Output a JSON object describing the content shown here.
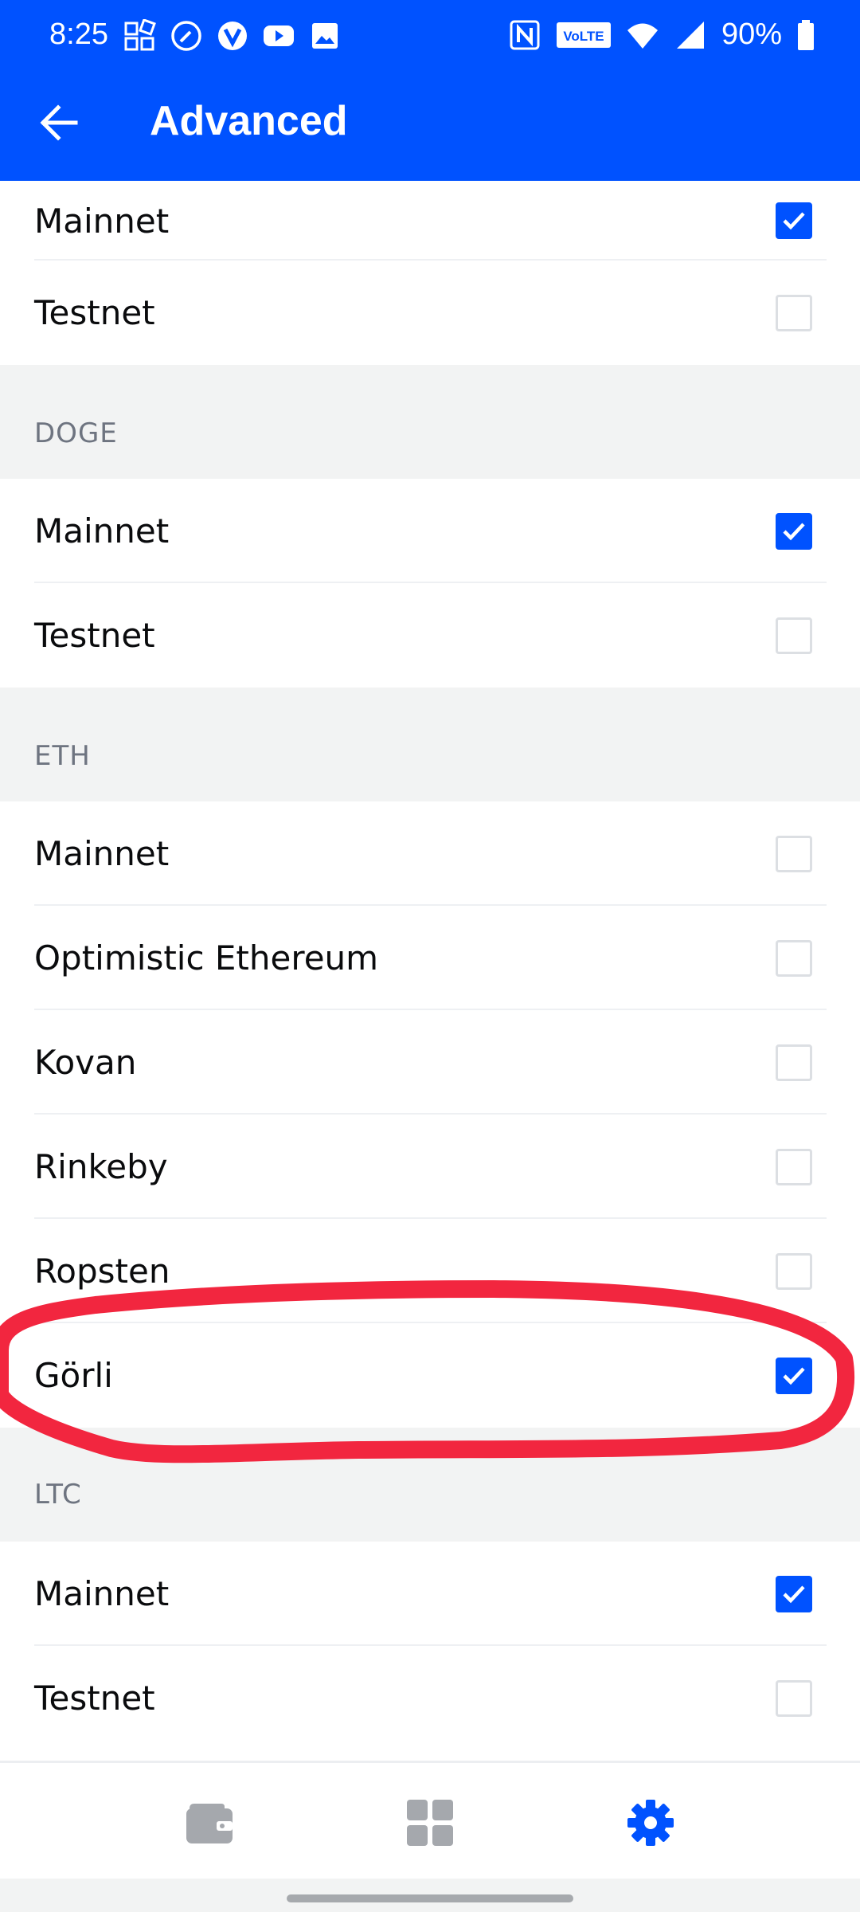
{
  "status_bar": {
    "time": "8:25",
    "battery": "90%",
    "volte": "VoLTE"
  },
  "app_bar": {
    "title": "Advanced"
  },
  "top_partial_rows": [
    {
      "label": "Mainnet",
      "checked": true
    },
    {
      "label": "Testnet",
      "checked": false
    }
  ],
  "sections": [
    {
      "title": "DOGE",
      "rows": [
        {
          "label": "Mainnet",
          "checked": true
        },
        {
          "label": "Testnet",
          "checked": false
        }
      ]
    },
    {
      "title": "ETH",
      "rows": [
        {
          "label": "Mainnet",
          "checked": false
        },
        {
          "label": "Optimistic Ethereum",
          "checked": false
        },
        {
          "label": "Kovan",
          "checked": false
        },
        {
          "label": "Rinkeby",
          "checked": false
        },
        {
          "label": "Ropsten",
          "checked": false
        },
        {
          "label": "Görli",
          "checked": true
        }
      ]
    },
    {
      "title": "LTC",
      "rows": [
        {
          "label": "Mainnet",
          "checked": true
        },
        {
          "label": "Testnet",
          "checked": false
        }
      ]
    }
  ],
  "bottom_nav": [
    {
      "icon": "wallet-icon",
      "active": false
    },
    {
      "icon": "grid-icon",
      "active": false
    },
    {
      "icon": "gear-icon",
      "active": true
    }
  ],
  "colors": {
    "brand": "#0052ff",
    "annotation": "#f2263f",
    "section_bg": "#f2f3f3"
  }
}
